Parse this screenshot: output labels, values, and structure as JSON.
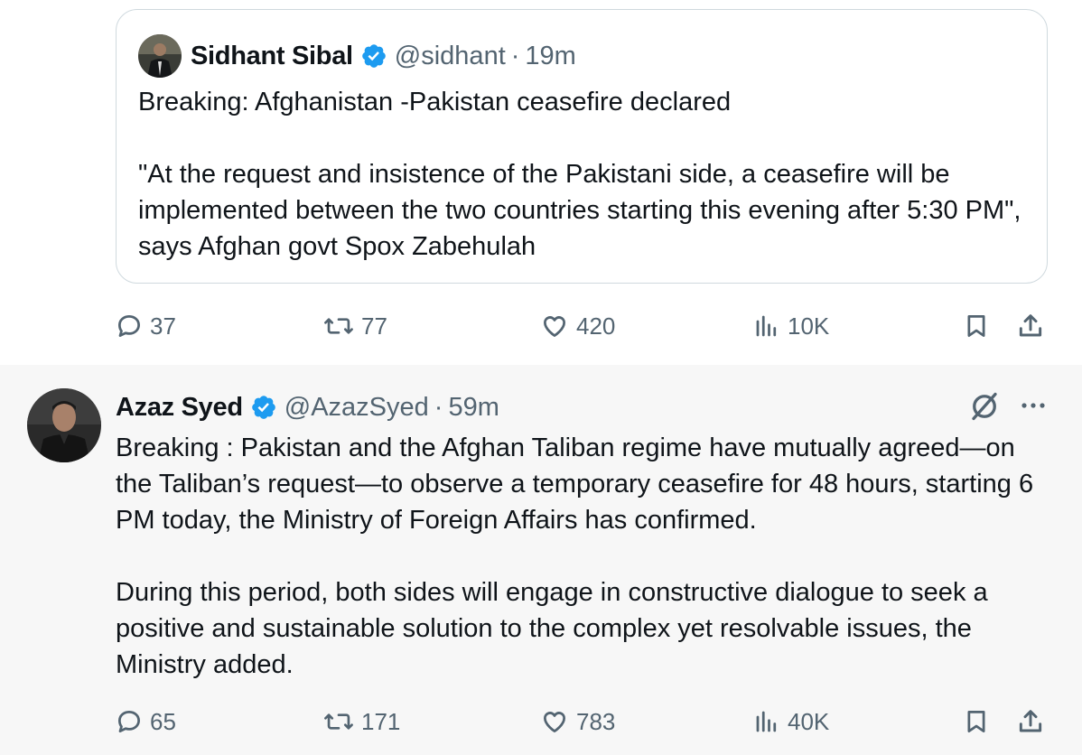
{
  "quoted_tweet": {
    "author_name": "Sidhant Sibal",
    "handle": "@sidhant",
    "separator": "·",
    "time": "19m",
    "paragraphs": [
      "Breaking: Afghanistan -Pakistan ceasefire declared",
      "\"At the request and insistence of the Pakistani side, a ceasefire will be implemented between the two countries starting this evening after 5:30 PM\", says Afghan govt Spox Zabehulah"
    ]
  },
  "tweet1_actions": {
    "replies": "37",
    "reposts": "77",
    "likes": "420",
    "views": "10K"
  },
  "tweet2": {
    "author_name": "Azaz Syed",
    "handle": "@AzazSyed",
    "separator": "·",
    "time": "59m",
    "paragraphs": [
      "Breaking : Pakistan and the Afghan Taliban regime have mutually agreed—on the Taliban’s request—to observe a temporary ceasefire for 48 hours, starting 6 PM today, the Ministry of Foreign Affairs has confirmed.",
      "During this period, both sides will engage in constructive dialogue to seek a positive and sustainable solution to the complex yet resolvable issues, the Ministry added."
    ]
  },
  "tweet2_actions": {
    "replies": "65",
    "reposts": "171",
    "likes": "783",
    "views": "40K"
  },
  "colors": {
    "text": "#0f1419",
    "secondary": "#536471",
    "verified": "#1d9bf0",
    "border": "#cfd9de",
    "highlight_bg": "#f7f7f7"
  },
  "icons": [
    "reply-icon",
    "repost-icon",
    "like-icon",
    "views-icon",
    "bookmark-icon",
    "share-icon",
    "verified-badge-icon",
    "grok-icon",
    "more-icon"
  ]
}
